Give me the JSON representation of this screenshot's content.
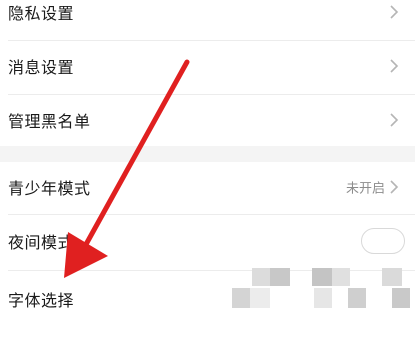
{
  "settings": {
    "items": [
      {
        "label": "隐私设置"
      },
      {
        "label": "消息设置"
      },
      {
        "label": "管理黑名单"
      },
      {
        "label": "青少年模式",
        "value": "未开启"
      },
      {
        "label": "夜间模式",
        "toggle_on": false
      },
      {
        "label": "字体选择"
      }
    ]
  },
  "icons": {
    "chevron": "chevron-right-icon",
    "annotation": "red-arrow-annotation"
  },
  "colors": {
    "arrow": "#e02020",
    "text": "#1a1a1a",
    "secondary_text": "#8c8c8c",
    "section_gap": "#f4f4f4"
  }
}
